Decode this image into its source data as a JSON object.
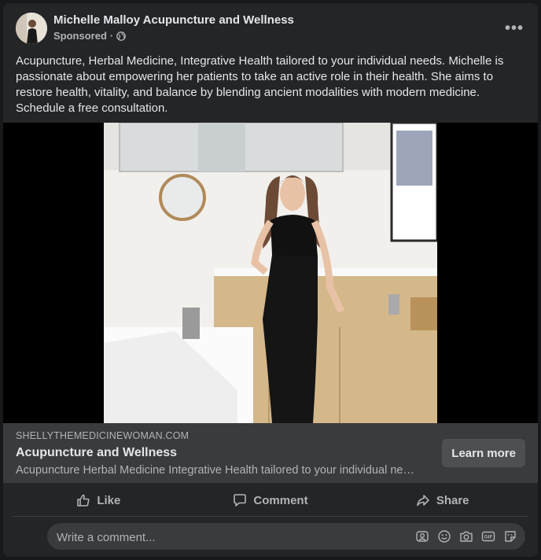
{
  "post": {
    "page_name": "Michelle Malloy Acupuncture and Wellness",
    "sponsored_label": "Sponsored",
    "meta_separator": "·",
    "more_options": "•••",
    "text": "Acupuncture, Herbal Medicine, Integrative Health tailored to your individual needs. Michelle is passionate about empowering her patients to take an active role in their health. She aims to restore health, vitality, and balance by blending ancient modalities with modern medicine. Schedule a free consultation."
  },
  "link_preview": {
    "domain": "SHELLYTHEMEDICINEWOMAN.COM",
    "title": "Acupuncture and Wellness",
    "description": "Acupuncture Herbal Medicine Integrative Health tailored to your individual needs.",
    "cta_label": "Learn more"
  },
  "actions": {
    "like_label": "Like",
    "comment_label": "Comment",
    "share_label": "Share"
  },
  "comment_box": {
    "placeholder": "Write a comment..."
  },
  "icons": {
    "globe": "globe-icon",
    "like": "thumbs-up-icon",
    "comment": "speech-bubble-icon",
    "share": "share-arrow-icon",
    "avatar_sticker": "avatar-sticker-icon",
    "emoji": "smiley-icon",
    "camera": "camera-icon",
    "gif": "gif-icon",
    "sticker": "sticker-icon"
  },
  "colors": {
    "background": "#18191a",
    "card": "#242526",
    "link_box": "#3a3b3c",
    "primary_text": "#e4e6eb",
    "secondary_text": "#b0b3b8"
  }
}
